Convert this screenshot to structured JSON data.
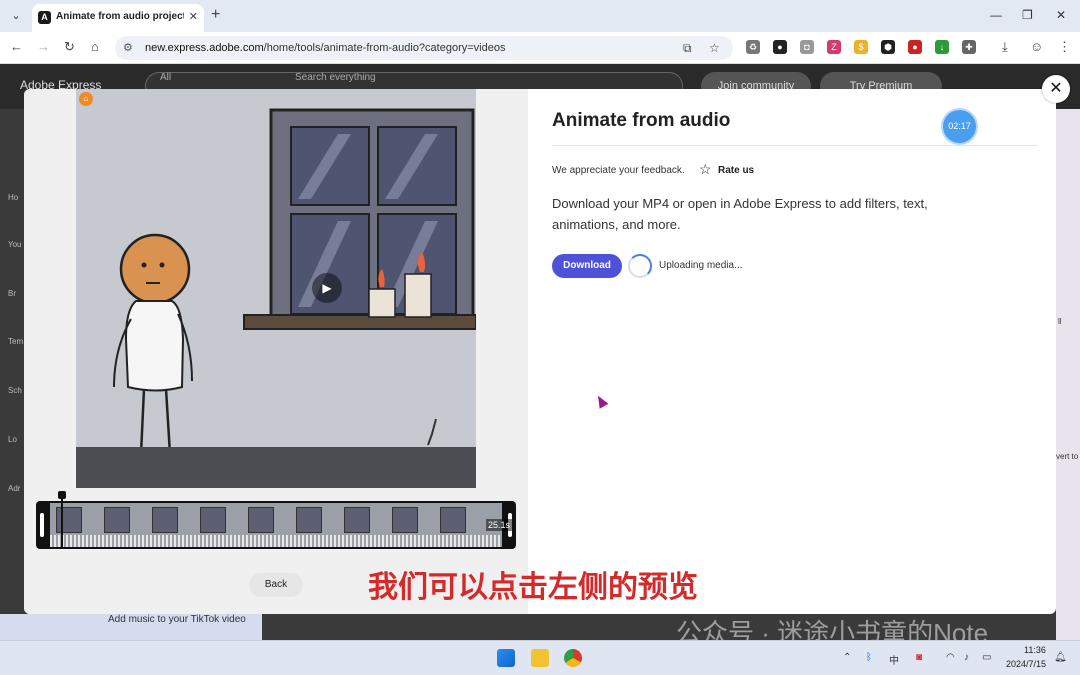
{
  "browser": {
    "tab_title": "Animate from audio project -",
    "url_domain": "new.express.adobe.com",
    "url_path": "/home/tools/animate-from-audio?category=videos",
    "colors": {
      "tab_bar": "#e3e9f2",
      "toolbar": "#ffffff"
    }
  },
  "page": {
    "brand": "Adobe Express",
    "search_scope": "All",
    "search_placeholder": "Search everything",
    "join_label": "Join community",
    "premium_label": "Try Premium",
    "side_nav": [
      "Ho",
      "You",
      "Br",
      "Tem",
      "Sch",
      "Lo",
      "Adr"
    ],
    "promo_label": "Add music to your TikTok video",
    "right_labels": [
      "ll",
      "vert to"
    ]
  },
  "modal": {
    "title": "Animate from audio",
    "timer": "02:17",
    "feedback_text": "We appreciate your feedback.",
    "rate_us_label": "Rate us",
    "description": "Download your MP4 or open in Adobe Express to add filters, text, animations, and more.",
    "download_label": "Download",
    "upload_status": "Uploading media...",
    "back_label": "Back",
    "timeline_duration": "25.1s",
    "accent_color": "#4e52d9"
  },
  "overlay": {
    "subtitle": "我们可以点击左侧的预览",
    "watermark": "公众号 · 迷途小书童的Note"
  },
  "taskbar": {
    "time": "11:36",
    "date": "2024/7/15"
  }
}
